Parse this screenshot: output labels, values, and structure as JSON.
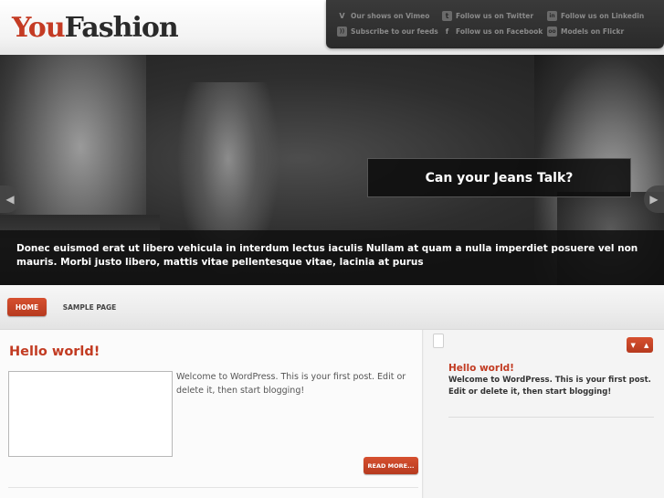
{
  "brand": {
    "part1": "You",
    "part2": "Fashion"
  },
  "social": [
    {
      "icon": "vimeo-icon",
      "glyph": "V",
      "label": "Our shows on Vimeo"
    },
    {
      "icon": "twitter-icon",
      "glyph": "t",
      "label": "Follow us on Twitter"
    },
    {
      "icon": "linkedin-icon",
      "glyph": "in",
      "label": "Follow us on Linkedin"
    },
    {
      "icon": "rss-icon",
      "glyph": "))",
      "label": "Subscribe to our feeds"
    },
    {
      "icon": "facebook-icon",
      "glyph": "f",
      "label": "Follow us on Facebook"
    },
    {
      "icon": "flickr-icon",
      "glyph": "oo",
      "label": "Models on Flickr"
    }
  ],
  "slider": {
    "title": "Can your Jeans Talk?",
    "caption": "Donec euismod erat ut libero vehicula in interdum lectus iaculis Nullam at quam a nulla imperdiet posuere vel non mauris. Morbi justo libero, mattis vitae pellentesque vitae, lacinia at purus",
    "prev": "◀",
    "next": "▶"
  },
  "nav": {
    "items": [
      {
        "label": "HOME",
        "active": true
      },
      {
        "label": "SAMPLE PAGE",
        "active": false
      }
    ]
  },
  "post": {
    "title": "Hello world!",
    "excerpt": "Welcome to WordPress. This is your first post. Edit or delete it, then start blogging!",
    "read_more": "READ MORE..."
  },
  "sidebar": {
    "controls": {
      "down": "▼",
      "up": "▲"
    },
    "title": "Hello world!",
    "text": "Welcome to WordPress. This is your first post. Edit or delete it, then start blogging!"
  },
  "colors": {
    "accent": "#c43b24",
    "dark": "#2a2a2a"
  }
}
